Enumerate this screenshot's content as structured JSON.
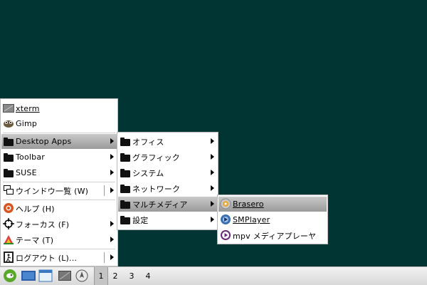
{
  "root_menu": {
    "items": [
      {
        "label": "xterm",
        "icon": "terminal-icon"
      },
      {
        "label": "Gimp",
        "icon": "gimp-icon"
      },
      {
        "label": "Desktop Apps",
        "icon": "folder-icon"
      },
      {
        "label": "Toolbar",
        "icon": "folder-icon"
      },
      {
        "label": "SUSE",
        "icon": "folder-icon"
      },
      {
        "label": "ウインドウ一覧 (W)",
        "icon": "window-list-icon"
      },
      {
        "label": "ヘルプ (H)",
        "icon": "help-icon"
      },
      {
        "label": "フォーカス (F)",
        "icon": "focus-icon"
      },
      {
        "label": "テーマ (T)",
        "icon": "theme-icon"
      },
      {
        "label": "ログアウト (L)...",
        "icon": "logout-icon"
      }
    ]
  },
  "desktop_apps_menu": {
    "items": [
      {
        "label": "オフィス"
      },
      {
        "label": "グラフィック"
      },
      {
        "label": "システム"
      },
      {
        "label": "ネットワーク"
      },
      {
        "label": "マルチメディア"
      },
      {
        "label": "設定"
      }
    ]
  },
  "multimedia_menu": {
    "items": [
      {
        "label": "Brasero",
        "icon": "brasero-icon"
      },
      {
        "label": "SMPlayer",
        "icon": "smplayer-icon"
      },
      {
        "label": "mpv メディアプレーヤ",
        "icon": "mpv-icon"
      }
    ]
  },
  "taskbar": {
    "desktops": [
      "1",
      "2",
      "3",
      "4"
    ],
    "active_desktop": "1"
  },
  "colors": {
    "desktop_bg": "#003534",
    "highlight": "#a6a6a6"
  }
}
